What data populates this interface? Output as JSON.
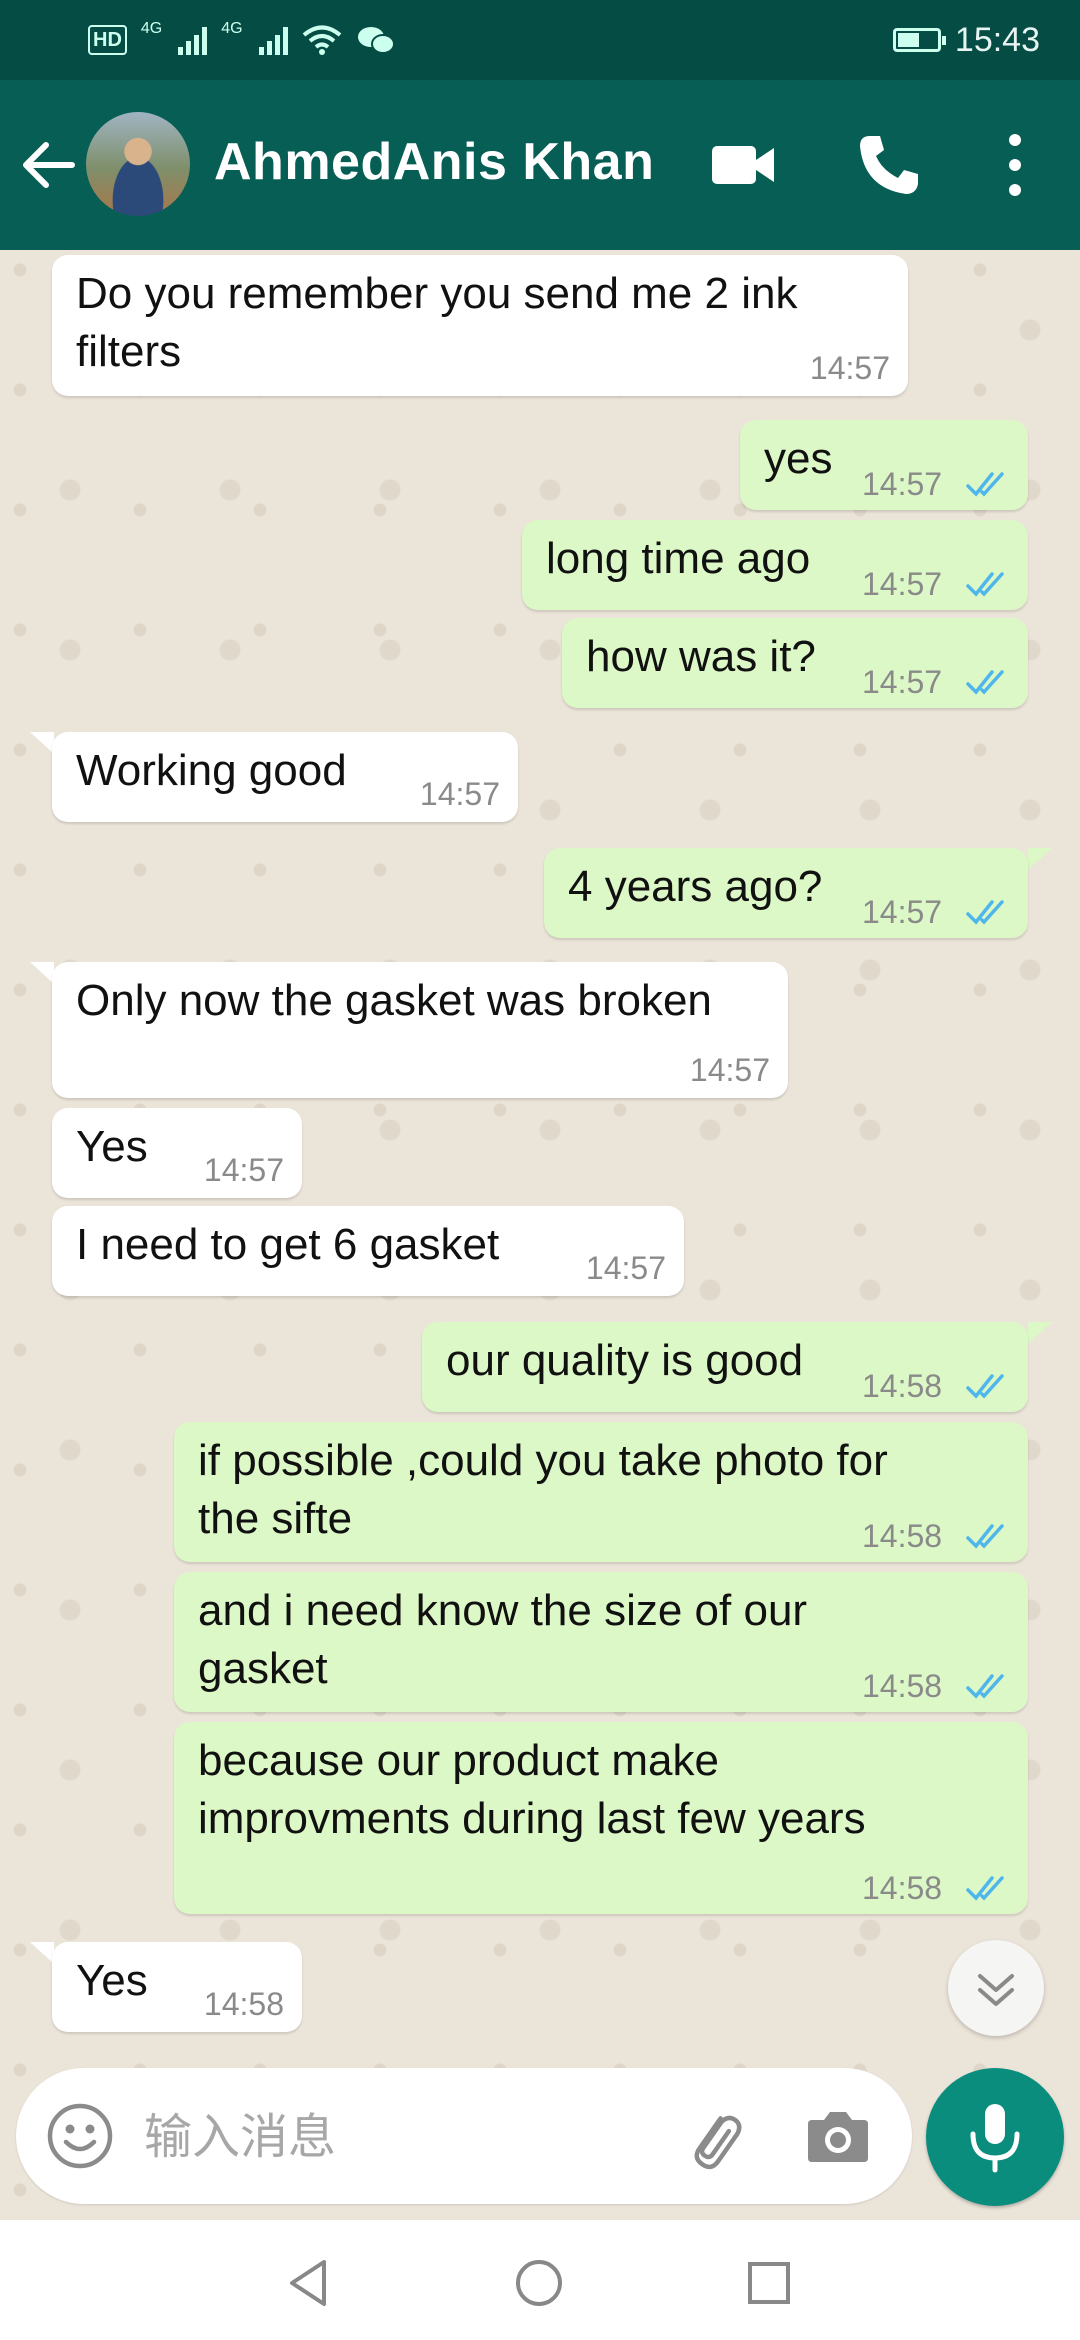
{
  "status_bar": {
    "hd": "HD",
    "net1": "4G",
    "net2": "4G",
    "time": "15:43",
    "battery_level": 0.55
  },
  "header": {
    "contact_name": "AhmedAnis Khan"
  },
  "messages": [
    {
      "dir": "in",
      "text": "Do you remember you send me 2 ink\nfilters",
      "time": "14:57"
    },
    {
      "dir": "out",
      "text": "yes",
      "time": "14:57",
      "read": true
    },
    {
      "dir": "out",
      "text": "long time ago",
      "time": "14:57",
      "read": true
    },
    {
      "dir": "out",
      "text": "how was it?",
      "time": "14:57",
      "read": true
    },
    {
      "dir": "in",
      "text": "Working good",
      "time": "14:57"
    },
    {
      "dir": "out",
      "text": "4 years ago?",
      "time": "14:57",
      "read": true
    },
    {
      "dir": "in",
      "text": "Only now the gasket was broken",
      "time": "14:57"
    },
    {
      "dir": "in",
      "text": "Yes",
      "time": "14:57"
    },
    {
      "dir": "in",
      "text": "I need to get 6 gasket",
      "time": "14:57"
    },
    {
      "dir": "out",
      "text": "our quality is good",
      "time": "14:58",
      "read": true
    },
    {
      "dir": "out",
      "text": "if possible ,could you take photo for\nthe sifte",
      "time": "14:58",
      "read": true
    },
    {
      "dir": "out",
      "text": "and i need know the size of our\ngasket",
      "time": "14:58",
      "read": true
    },
    {
      "dir": "out",
      "text": "because our product make\nimprovments during last few years",
      "time": "14:58",
      "read": true
    },
    {
      "dir": "in",
      "text": "Yes",
      "time": "14:58"
    }
  ],
  "composer": {
    "placeholder": "输入消息"
  },
  "colors": {
    "header": "#075e54",
    "incoming": "#ffffff",
    "outgoing": "#dcf8c6",
    "tick": "#4fb6ec",
    "mic": "#0a8d7d"
  },
  "icons": {
    "back": "arrow-left-icon",
    "video": "video-camera-icon",
    "call": "phone-icon",
    "menu": "more-vert-icon",
    "emoji": "emoji-icon",
    "attach": "paperclip-icon",
    "camera": "camera-icon",
    "mic": "microphone-icon",
    "scroll": "double-chevron-down-icon"
  }
}
